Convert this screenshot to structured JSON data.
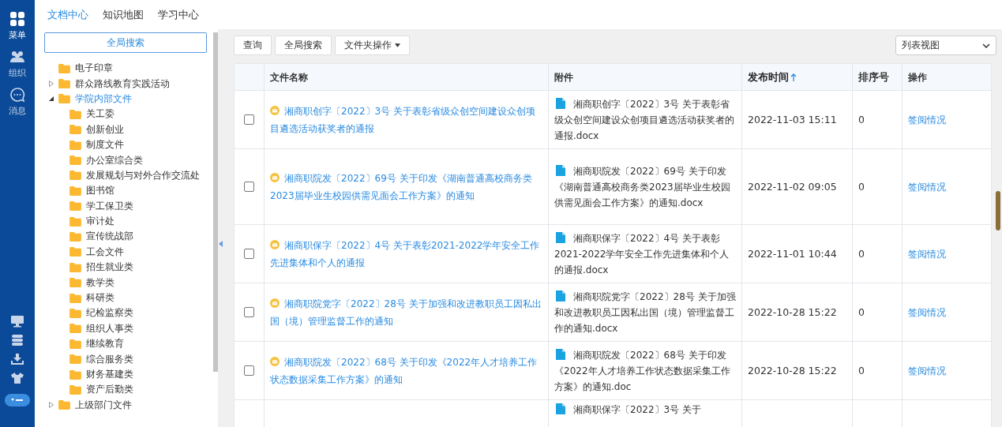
{
  "rail": {
    "top": [
      {
        "kind": "grid",
        "label": "菜单"
      },
      {
        "kind": "people",
        "label": "组织"
      },
      {
        "kind": "chat",
        "label": "消息"
      }
    ],
    "bottom": [
      {
        "kind": "monitor"
      },
      {
        "kind": "stack"
      },
      {
        "kind": "download"
      },
      {
        "kind": "shirt"
      },
      {
        "kind": "toggle"
      }
    ]
  },
  "nav_tabs": [
    {
      "label": "文档中心",
      "selected": true
    },
    {
      "label": "知识地图",
      "selected": false
    },
    {
      "label": "学习中心",
      "selected": false
    }
  ],
  "tree": {
    "search_button": "全局搜索",
    "items": [
      {
        "label": "电子印章",
        "kind": "leaf",
        "expanded": false,
        "selected": false
      },
      {
        "label": "群众路线教育实践活动",
        "kind": "group",
        "expanded": false,
        "selected": false
      },
      {
        "label": "学院内部文件",
        "kind": "group",
        "expanded": true,
        "selected": true,
        "children": [
          {
            "label": "关工委",
            "selected": false
          },
          {
            "label": "创新创业",
            "selected": false
          },
          {
            "label": "制度文件",
            "selected": false
          },
          {
            "label": "办公室综合类",
            "selected": false
          },
          {
            "label": "发展规划与对外合作交流处",
            "selected": false
          },
          {
            "label": "图书馆",
            "selected": false
          },
          {
            "label": "学工保卫类",
            "selected": false
          },
          {
            "label": "审计处",
            "selected": false
          },
          {
            "label": "宣传统战部",
            "selected": false
          },
          {
            "label": "工会文件",
            "selected": false
          },
          {
            "label": "招生就业类",
            "selected": false
          },
          {
            "label": "教学类",
            "selected": false
          },
          {
            "label": "科研类",
            "selected": false
          },
          {
            "label": "纪检监察类",
            "selected": false
          },
          {
            "label": "组织人事类",
            "selected": false
          },
          {
            "label": "继续教育",
            "selected": false
          },
          {
            "label": "综合服务类",
            "selected": false
          },
          {
            "label": "财务基建类",
            "selected": false
          },
          {
            "label": "资产后勤类",
            "selected": false
          }
        ]
      },
      {
        "label": "上级部门文件",
        "kind": "group",
        "expanded": false,
        "selected": false
      }
    ]
  },
  "toolbar": {
    "buttons": [
      {
        "label": "查询",
        "kind": "plain"
      },
      {
        "label": "全局搜索",
        "kind": "plain"
      },
      {
        "label": "文件夹操作",
        "kind": "dropdown"
      }
    ],
    "view_select": "列表视图"
  },
  "table": {
    "columns": [
      {
        "label": "文件名称",
        "sorted": false
      },
      {
        "label": "附件",
        "sorted": false
      },
      {
        "label": "发布时间",
        "sorted": true
      },
      {
        "label": "排序号",
        "sorted": false
      },
      {
        "label": "操作",
        "sorted": false
      }
    ],
    "rows": [
      {
        "checked": false,
        "name": "湘商职创字〔2022〕3号 关于表彰省级众创空间建设众创项目遴选活动获奖者的通报",
        "attachment": "湘商职创字〔2022〕3号 关于表彰省级众创空间建设众创项目遴选活动获奖者的通报.docx",
        "time": "2022-11-03 15:11",
        "order": "0",
        "action": "签阅情况"
      },
      {
        "checked": false,
        "name": "湘商职院发〔2022〕69号 关于印发《湖南普通高校商务类2023届毕业生校园供需见面会工作方案》的通知",
        "attachment": "湘商职院发〔2022〕69号 关于印发《湖南普通高校商务类2023届毕业生校园供需见面会工作方案》的通知.docx",
        "time": "2022-11-02 09:05",
        "order": "0",
        "action": "签阅情况"
      },
      {
        "checked": false,
        "name": "湘商职保字〔2022〕4号 关于表彰2021-2022学年安全工作先进集体和个人的通报",
        "attachment": "湘商职保字〔2022〕4号 关于表彰2021-2022学年安全工作先进集体和个人的通报.docx",
        "time": "2022-11-01 10:44",
        "order": "0",
        "action": "签阅情况"
      },
      {
        "checked": false,
        "name": "湘商职院党字〔2022〕28号 关于加强和改进教职员工因私出国（境）管理监督工作的通知",
        "attachment": "湘商职院党字〔2022〕28号 关于加强和改进教职员工因私出国（境）管理监督工作的通知.docx",
        "time": "2022-10-28 15:22",
        "order": "0",
        "action": "签阅情况"
      },
      {
        "checked": false,
        "name": "湘商职院发〔2022〕68号 关于印发《2022年人才培养工作状态数据采集工作方案》的通知",
        "attachment": "湘商职院发〔2022〕68号 关于印发《2022年人才培养工作状态数据采集工作方案》的通知.doc",
        "time": "2022-10-28 15:22",
        "order": "0",
        "action": "签阅情况"
      }
    ],
    "partial_row": {
      "attachment": "湘商职保字〔2022〕3号 关于"
    }
  }
}
